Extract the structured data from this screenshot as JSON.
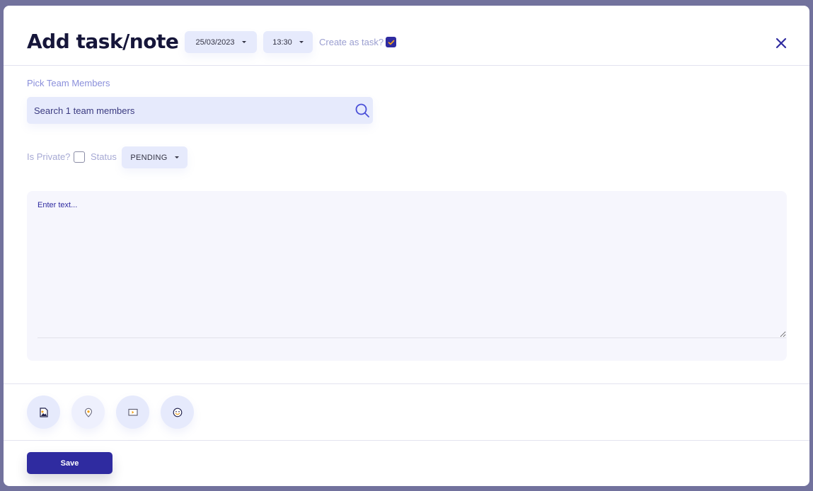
{
  "header": {
    "title": "Add task/note",
    "date": "25/03/2023",
    "time": "13:30",
    "create_as_task_label": "Create as task?",
    "create_as_task_checked": true
  },
  "team": {
    "label": "Pick Team Members",
    "search_placeholder": "Search 1 team members"
  },
  "options": {
    "private_label": "Is Private?",
    "private_checked": false,
    "status_label": "Status",
    "status_value": "PENDING"
  },
  "editor": {
    "placeholder": "Enter text..."
  },
  "media_buttons": [
    {
      "icon": "image-icon"
    },
    {
      "icon": "location-pin-icon"
    },
    {
      "icon": "video-icon"
    },
    {
      "icon": "emoji-icon"
    }
  ],
  "footer": {
    "save_label": "Save"
  },
  "colors": {
    "primary": "#2f2ba0",
    "accent": "#f0a11f",
    "pill_bg": "#e6eafc",
    "backdrop": "#72729d"
  }
}
